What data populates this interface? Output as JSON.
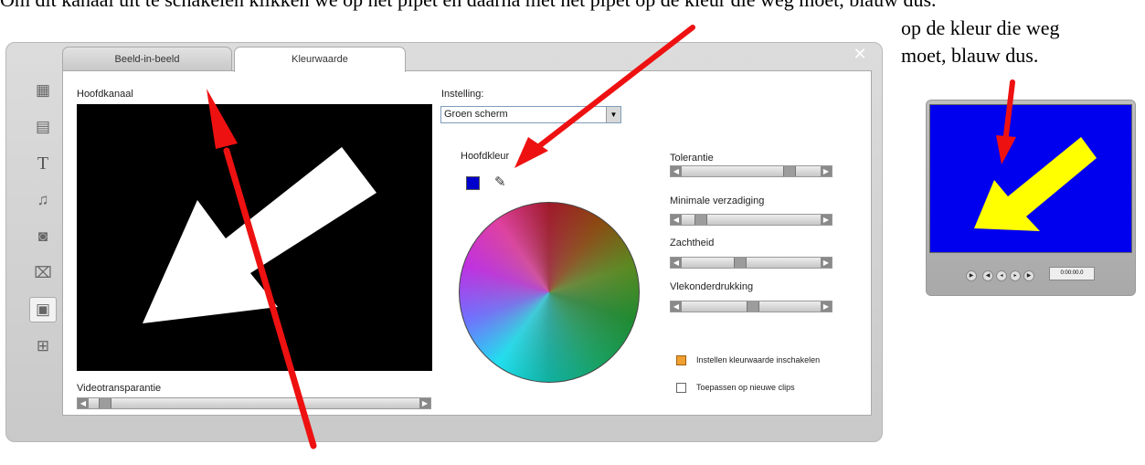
{
  "document": {
    "top_caption": "Om dit kanaal uit te schakelen klikken we op het pipet en daarna met het pipet op de kleur die weg moet, blauw dus.",
    "side_caption": [
      "op de kleur die weg",
      "moet, blauw dus."
    ]
  },
  "dialog": {
    "tabs": [
      "Beeld-in-beeld",
      "Kleurwaarde"
    ],
    "active_tab": "Kleurwaarde",
    "close_icon": "close-icon",
    "toolbar_icons": [
      "titles-icon",
      "transitions-icon",
      "text-icon",
      "audio-icon",
      "camera-icon",
      "clapper-icon",
      "chromakey-icon",
      "effects-icon"
    ],
    "main_channel_label": "Hoofdkanaal",
    "setting_label": "Instelling:",
    "setting_value": "Groen scherm",
    "main_color_label": "Hoofdkleur",
    "main_color": "#0000cc",
    "video_transparency_label": "Videotransparantie",
    "sliders": [
      {
        "label": "Tolerantie",
        "value": 0.78
      },
      {
        "label": "Minimale verzadiging",
        "value": 0.1
      },
      {
        "label": "Zachtheid",
        "value": 0.4
      },
      {
        "label": "Vlekonderdrukking",
        "value": 0.5
      }
    ],
    "video_transparency_value": 0.03,
    "checkboxes": [
      {
        "label": "Instellen kleurwaarde inschakelen",
        "checked": true
      },
      {
        "label": "Toepassen op nieuwe clips",
        "checked": false
      }
    ]
  },
  "preview": {
    "screen_color": "#0000ee",
    "arrow_color": "#ffff00",
    "timecode": "0:00:00.0"
  },
  "annotations": {
    "arrow_color": "#ee1111"
  }
}
